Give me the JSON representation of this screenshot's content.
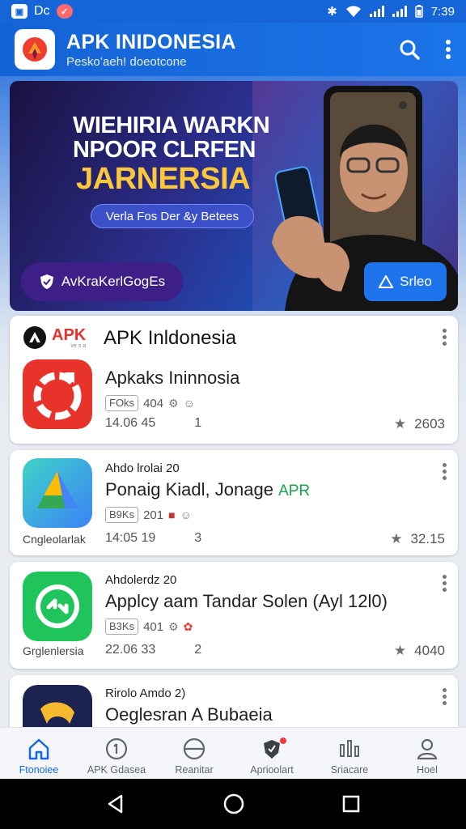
{
  "status_bar": {
    "left_icons": [
      "app-notification-icon",
      "dc-notification-icon",
      "shield-notification-icon"
    ],
    "dc_label": "Dc",
    "time": "7:39"
  },
  "app_bar": {
    "title": "APK INIDONESIA",
    "subtitle": "Peskoʻaeh! doeotcone"
  },
  "banner": {
    "headline_line1": "WIEHIRIA WARKN",
    "headline_line2": "NPOOR CLRFEN",
    "highlight": "JARNERSIA",
    "pill": "Verla Fos Der &y Betees",
    "cta_left": "AvKraKerlGogEs",
    "cta_right": "Srleo"
  },
  "cards": [
    {
      "brand": "APK",
      "brand_small": "ve s a",
      "header": "APK Inldonesia",
      "name": "Apkaks Ininnosia",
      "tag": "FOks",
      "size": "404",
      "date": "14.06 45",
      "count": "1",
      "rating": "2603",
      "icon_color": "#e83a30"
    },
    {
      "caption": "Ahdo lrolai 20",
      "name": "Ponaig Kiadl, Jonage",
      "badge": "APR",
      "tag": "B9Ks",
      "size": "201",
      "date": "14:05 19",
      "count": "3",
      "rating": "32.15",
      "label": "Cngleolarlak"
    },
    {
      "caption": "Ahdolerdz 20",
      "name": "Applcy aam Tandar Solen (Ayl 12l0)",
      "tag": "B3Ks",
      "size": "401",
      "date": "22.06 33",
      "count": "2",
      "rating": "4040",
      "label": "Grglenlersia"
    },
    {
      "caption": "Rirolo Amdo 2)",
      "name": "Oeglesran A Bubaeia"
    }
  ],
  "bottom_nav": [
    {
      "label": "Ftonoiee",
      "icon": "home-icon",
      "active": true
    },
    {
      "label": "APK Gdasea",
      "icon": "clock-icon",
      "active": false
    },
    {
      "label": "Reanitar",
      "icon": "globe-icon",
      "active": false
    },
    {
      "label": "Aprioolart",
      "icon": "tag-icon",
      "active": false
    },
    {
      "label": "Sriacare",
      "icon": "equalizer-icon",
      "active": false
    },
    {
      "label": "Hoel",
      "icon": "person-icon",
      "active": false
    }
  ],
  "colors": {
    "primary": "#1669e0",
    "highlight_yellow": "#ffc83a",
    "banner_purple": "#3e1f87"
  }
}
